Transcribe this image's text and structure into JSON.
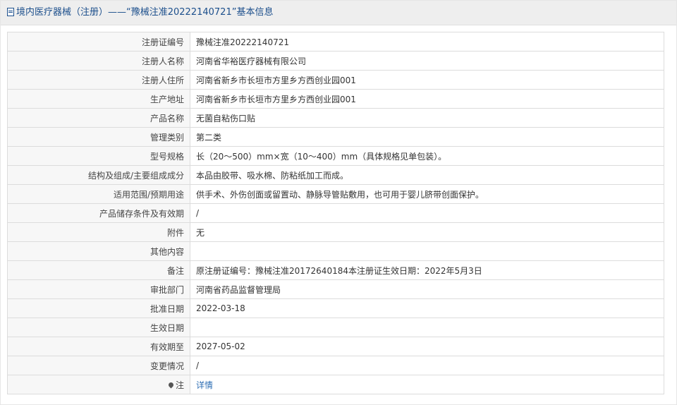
{
  "header": {
    "title": "境内医疗器械（注册）——“豫械注准20222140721”基本信息",
    "icon": "document-icon"
  },
  "rows": [
    {
      "label": "注册证编号",
      "value": "豫械注准20222140721"
    },
    {
      "label": "注册人名称",
      "value": "河南省华裕医疗器械有限公司"
    },
    {
      "label": "注册人住所",
      "value": "河南省新乡市长垣市方里乡方西创业园001"
    },
    {
      "label": "生产地址",
      "value": "河南省新乡市长垣市方里乡方西创业园001"
    },
    {
      "label": "产品名称",
      "value": "无菌自粘伤口贴"
    },
    {
      "label": "管理类别",
      "value": "第二类"
    },
    {
      "label": "型号规格",
      "value": "长（20～500）mm×宽（10～400）mm（具体规格见单包装）。"
    },
    {
      "label": "结构及组成/主要组成成分",
      "value": "本品由胶带、吸水棉、防粘纸加工而成。"
    },
    {
      "label": "适用范围/预期用途",
      "value": "供手术、外伤创面或留置动、静脉导管贴敷用，也可用于婴儿脐带创面保护。"
    },
    {
      "label": "产品储存条件及有效期",
      "value": "/"
    },
    {
      "label": "附件",
      "value": "无"
    },
    {
      "label": "其他内容",
      "value": ""
    },
    {
      "label": "备注",
      "value": "原注册证编号：豫械注准20172640184本注册证生效日期：2022年5月3日"
    },
    {
      "label": "审批部门",
      "value": "河南省药品监督管理局"
    },
    {
      "label": "批准日期",
      "value": "2022-03-18"
    },
    {
      "label": "生效日期",
      "value": ""
    },
    {
      "label": "有效期至",
      "value": "2027-05-02"
    },
    {
      "label": "变更情况",
      "value": "/"
    }
  ],
  "note": {
    "label": "注",
    "icon": "pin-icon",
    "link_text": "详情"
  },
  "colors": {
    "header_text": "#1c4f8c",
    "link": "#2f6fb4",
    "label_bg": "#f7f7f7"
  }
}
